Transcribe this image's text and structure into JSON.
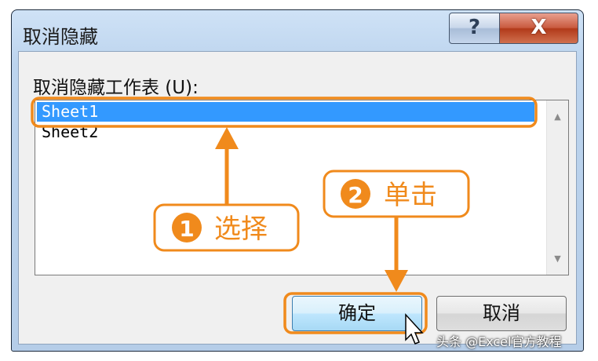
{
  "dialog": {
    "title": "取消隐藏",
    "help_glyph": "?",
    "close_glyph": "X",
    "list_label": "取消隐藏工作表 (U):",
    "sheets": [
      "Sheet1",
      "Sheet2"
    ],
    "selected_sheet": "Sheet1",
    "ok_label": "确定",
    "cancel_label": "取消"
  },
  "annotations": {
    "step1_number": "1",
    "step1_label": "选择",
    "step2_number": "2",
    "step2_label": "单击",
    "accent_color": "#f08a1c"
  },
  "watermark": "头条 @Excel官方教程"
}
